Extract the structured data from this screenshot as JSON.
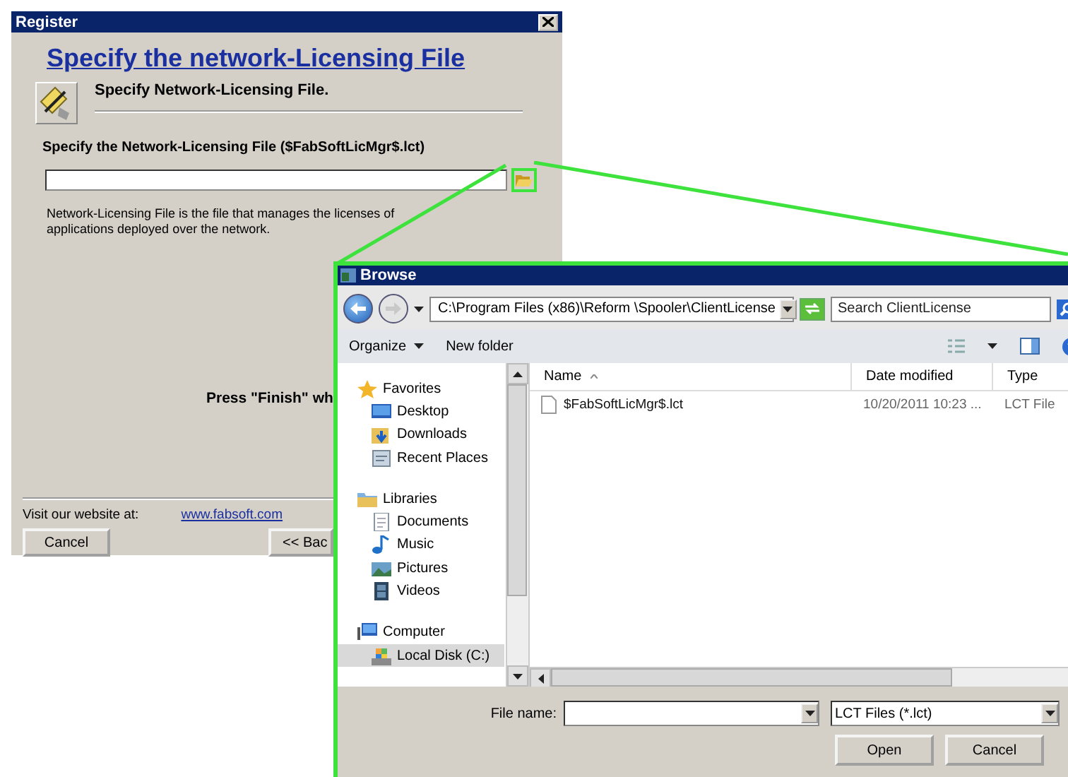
{
  "register": {
    "title": "Register",
    "heading": "Specify the network-Licensing File",
    "step_title": "Specify Network-Licensing File.",
    "field_label": "Specify the Network-Licensing File ($FabSoftLicMgr$.lct)",
    "description": "Network-Licensing File is the file that manages the licenses of applications deployed over the network.",
    "finish_hint": "Press \"Finish\" wh",
    "website_label": "Visit our website at:",
    "website_link": "www.fabsoft.com",
    "buttons": [
      "Cancel",
      "<< Bac"
    ]
  },
  "browse": {
    "title": "Browse",
    "address": "C:\\Program Files (x86)\\Reform \\Spooler\\ClientLicense",
    "search_placeholder": "Search ClientLicense",
    "toolbar": [
      "Organize",
      "New folder"
    ],
    "nav": [
      {
        "label": "Favorites",
        "kind": "star",
        "selected": false,
        "children": [
          {
            "label": "Desktop",
            "kind": "desktop",
            "selected": false
          },
          {
            "label": "Downloads",
            "kind": "downloads",
            "selected": false
          },
          {
            "label": "Recent Places",
            "kind": "recent",
            "selected": false
          }
        ]
      },
      {
        "label": "Libraries",
        "kind": "library",
        "selected": false,
        "children": [
          {
            "label": "Documents",
            "kind": "document",
            "selected": false
          },
          {
            "label": "Music",
            "kind": "music",
            "selected": false
          },
          {
            "label": "Pictures",
            "kind": "pictures",
            "selected": false
          },
          {
            "label": "Videos",
            "kind": "video",
            "selected": false
          }
        ]
      },
      {
        "label": "Computer",
        "kind": "computer",
        "selected": false,
        "children": [
          {
            "label": "Local Disk (C:)",
            "kind": "disk",
            "selected": true
          }
        ]
      }
    ],
    "columns": [
      "Name",
      "Date modified",
      "Type"
    ],
    "files": [
      {
        "name": "$FabSoftLicMgr$.lct",
        "date": "10/20/2011 10:23 ...",
        "type": "LCT File"
      }
    ],
    "file_name_label": "File name:",
    "file_type": "LCT Files (*.lct)",
    "buttons": [
      "Open",
      "Cancel"
    ]
  }
}
